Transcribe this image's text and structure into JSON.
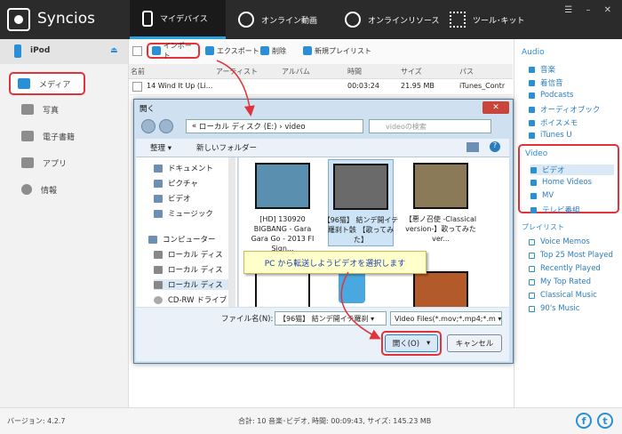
{
  "app": {
    "title": "Syncios"
  },
  "nav": {
    "tabs": [
      {
        "label": "マイデバイス",
        "icon": "phone-icon"
      },
      {
        "label": "オンライン動画",
        "icon": "play-icon"
      },
      {
        "label": "オンラインリソース",
        "icon": "download-icon"
      },
      {
        "label": "ツール･キット",
        "icon": "grid-icon"
      }
    ]
  },
  "sidebar": {
    "device": "iPod",
    "items": [
      {
        "label": "メディア",
        "icon": "media-icon"
      },
      {
        "label": "写真",
        "icon": "photo-icon"
      },
      {
        "label": "電子書籍",
        "icon": "book-icon"
      },
      {
        "label": "アプリ",
        "icon": "apps-icon"
      },
      {
        "label": "情報",
        "icon": "info-icon"
      }
    ]
  },
  "toolbar": {
    "import": "インポート",
    "export": "エクスポート",
    "delete": "削除",
    "new_playlist": "新規プレイリスト"
  },
  "table": {
    "headers": [
      "名前",
      "アーティスト",
      "アルバム",
      "時間",
      "サイズ",
      "パス"
    ],
    "rows": [
      {
        "name": "14 Wind It Up (Li...",
        "time": "00:03:24",
        "size": "21.95 MB",
        "path": "iTunes_Contr"
      }
    ]
  },
  "right": {
    "audio_title": "Audio",
    "audio": [
      "音楽",
      "着信音",
      "Podcasts",
      "オーディオブック",
      "ボイスメモ",
      "iTunes U"
    ],
    "video_title": "Video",
    "video": [
      "ビデオ",
      "Home Videos",
      "MV",
      "テレビ番組"
    ],
    "playlist_title": "プレイリスト",
    "playlists": [
      "Voice Memos",
      "Top 25 Most Played",
      "Recently Played",
      "My Top Rated",
      "Classical Music",
      "90's Music"
    ]
  },
  "status": {
    "version": "バージョン: 4.2.7",
    "summary": "合計: 10 音楽･ビデオ, 時間: 00:09:43, サイズ: 145.23 MB"
  },
  "dialog": {
    "title": "開く",
    "address_prefix": "«",
    "address": "ローカル ディスク (E:) › video",
    "search": "videoの検索",
    "organize": "整理 ▾",
    "new_folder": "新しいフォルダー",
    "nav_items": [
      "ドキュメント",
      "ピクチャ",
      "ビデオ",
      "ミュージック",
      "コンピューター",
      "ローカル ディス",
      "ローカル ディス",
      "ローカル ディス",
      "CD-RW ドライブ"
    ],
    "files": [
      "[HD] 130920 BIGBANG - Gara Gara Go - 2013 FI Sign...",
      "【96猫】 結ンデ開イテ羅刹ト骸 【歌ってみた】",
      "【悪ノ召使 -Classical version-】歌ってみた ver..."
    ],
    "filename_label": "ファイル名(N):",
    "filename_value": "【96猫】 結ンデ開イテ羅刹 ▾",
    "filetype": "Video Files(*.mov;*.mp4;*.m ▾",
    "open": "開く(O)",
    "cancel": "キャンセル"
  },
  "callout": "PC から転送しようビデオを選択します",
  "colors": {
    "accent": "#29a3e0",
    "highlight": "#e0333a"
  }
}
